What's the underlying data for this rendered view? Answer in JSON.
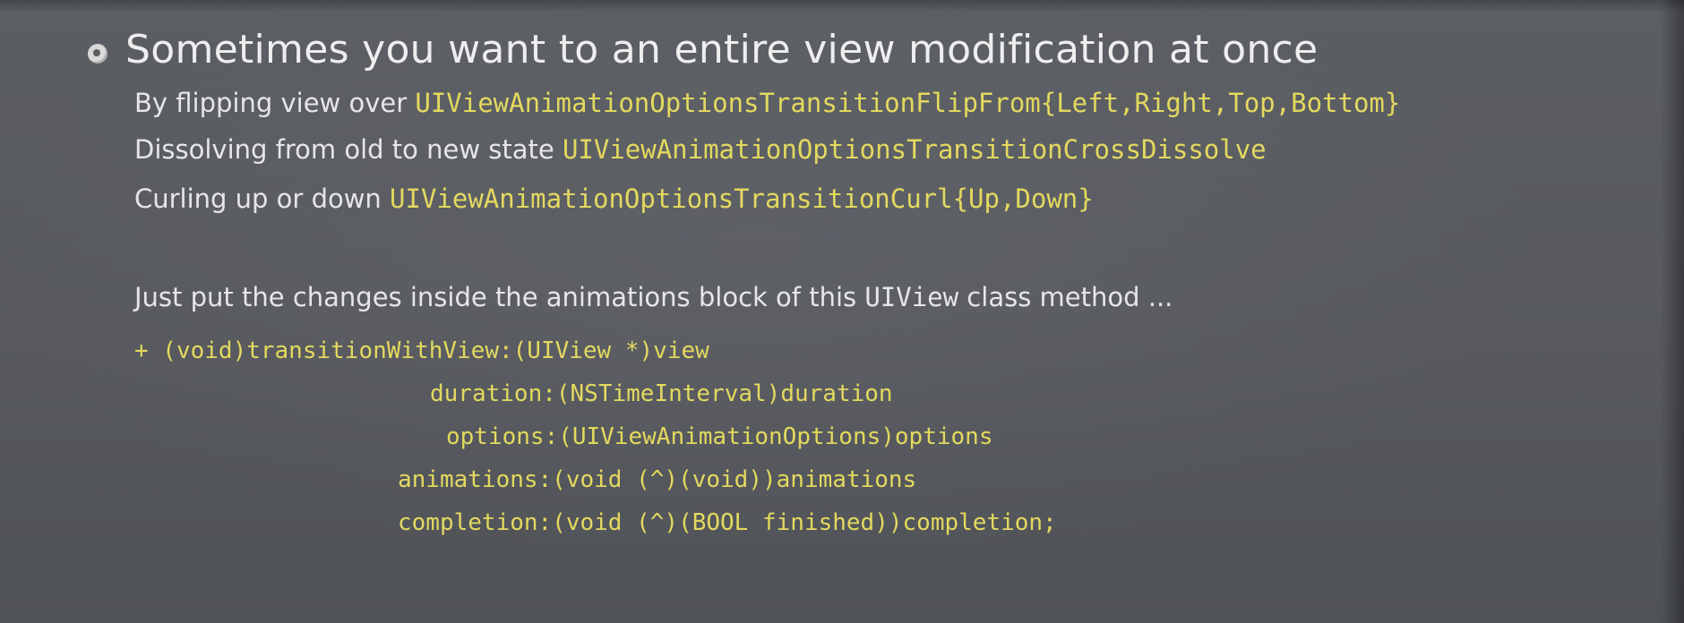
{
  "slide": {
    "heading": "Sometimes you want to an entire view modification at once",
    "lines": [
      {
        "text": "By flipping view over ",
        "code": "UIViewAnimationOptionsTransitionFlipFrom{Left,Right,Top,Bottom}"
      },
      {
        "text": "Dissolving from old to new state ",
        "code": "UIViewAnimationOptionsTransitionCrossDissolve"
      },
      {
        "text": "Curling up or down ",
        "code": "UIViewAnimationOptionsTransitionCurl{Up,Down}"
      }
    ],
    "instruction": {
      "text_before": "Just put the changes inside the animations block of this ",
      "code": "UIView",
      "text_after": " class method ..."
    },
    "method_signature": [
      "+ (void)transitionWithView:(UIView *)view",
      "duration:(NSTimeInterval)duration",
      "options:(UIViewAnimationOptions)options",
      "animations:(void (^)(void))animations",
      "completion:(void (^)(BOOL finished))completion;"
    ]
  },
  "colors": {
    "background": "#57595e",
    "text": "#e6e6e6",
    "code": "#e3d95f"
  },
  "icons": {
    "bullet": "bullet-circle-icon"
  }
}
